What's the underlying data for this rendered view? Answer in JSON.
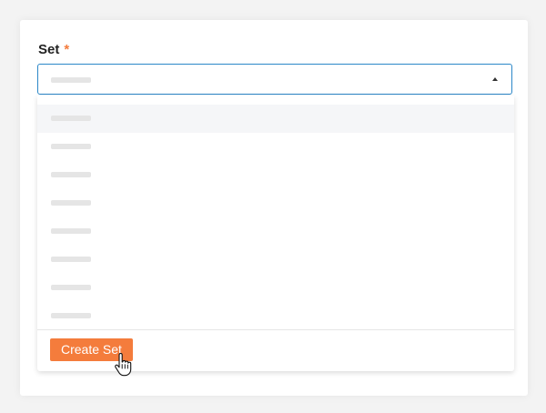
{
  "field": {
    "label": "Set",
    "required_mark": "*"
  },
  "select": {
    "state": "open",
    "caret_icon": "caret-up-icon",
    "selected_value_placeholder": true
  },
  "dropdown": {
    "option_count": 8,
    "highlighted_index": 0
  },
  "footer": {
    "create_button_label": "Create Set"
  },
  "colors": {
    "accent": "#f47c3c",
    "focus_border": "#2b87c8",
    "placeholder": "#e5e5e5",
    "highlight_bg": "#f5f6f8"
  },
  "cursor_icon": "hand-pointer-icon"
}
